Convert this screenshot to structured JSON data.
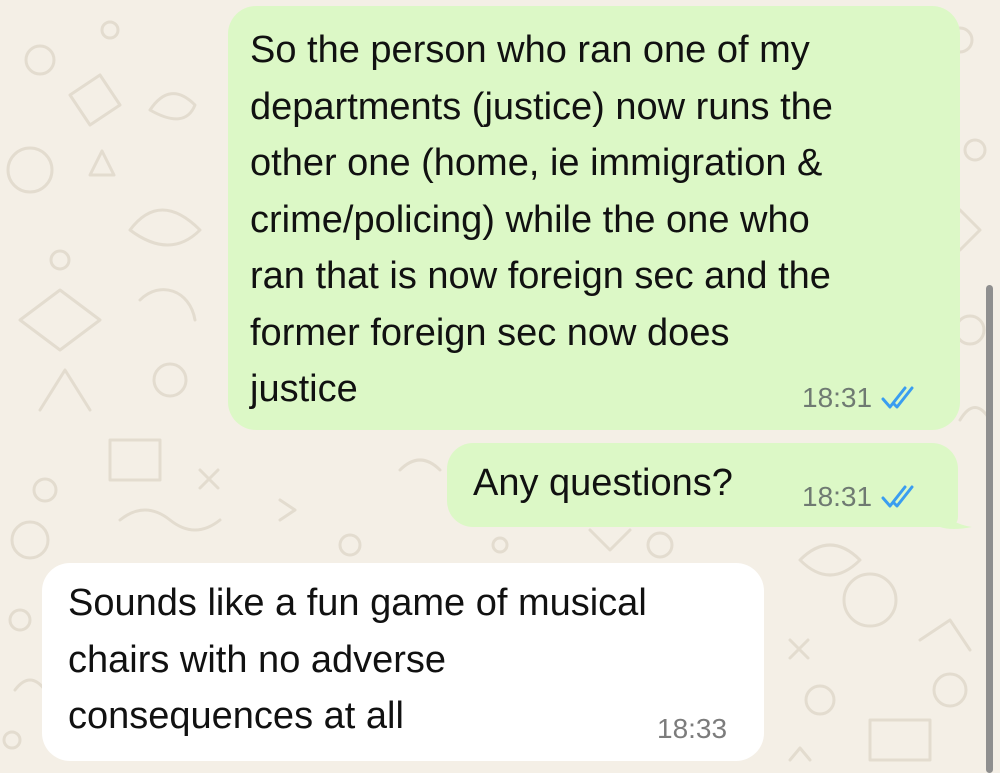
{
  "chat": {
    "messages": [
      {
        "direction": "outgoing",
        "text": "So the person who ran one of my\ndepartments (justice) now runs the\nother one (home, ie immigration &\ncrime/policing) while the one who\nran that is now foreign sec and the\nformer foreign sec now does\njustice",
        "time": "18:31",
        "status_icon": "double-check-read-icon"
      },
      {
        "direction": "outgoing",
        "text": "Any questions?",
        "time": "18:31",
        "status_icon": "double-check-read-icon"
      },
      {
        "direction": "incoming",
        "text": "Sounds like a fun game of musical\nchairs with no adverse\nconsequences at all",
        "time": "18:33"
      }
    ]
  },
  "colors": {
    "wallpaper": "#f4efe6",
    "doodle_stroke": "#e3dccf",
    "outgoing_bubble": "#dcf8c6",
    "incoming_bubble": "#ffffff",
    "read_ticks": "#3a9df0",
    "timestamp": "#6f7a72"
  }
}
